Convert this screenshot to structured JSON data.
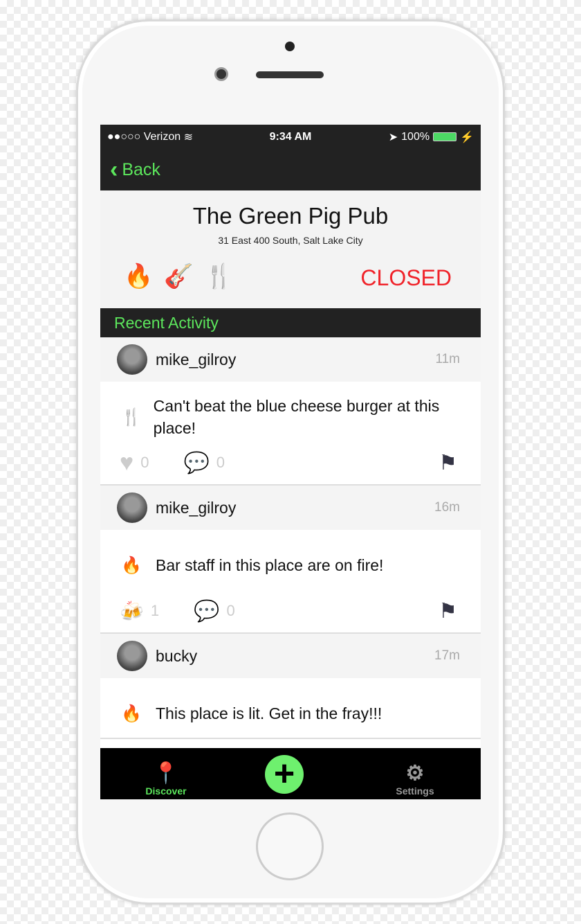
{
  "status": {
    "carrier": "●●○○○ Verizon",
    "time": "9:34 AM",
    "battery": "100%"
  },
  "nav": {
    "back": "Back"
  },
  "venue": {
    "name": "The Green Pig Pub",
    "address": "31 East 400 South, Salt Lake City",
    "status": "CLOSED",
    "icons": [
      "🔥",
      "🎸",
      "🍴"
    ]
  },
  "section": "Recent Activity",
  "posts": [
    {
      "user": "mike_gilroy",
      "time": "11m",
      "icon": "🍴",
      "text": "Can't beat the blue cheese burger at this place!",
      "likes": "0",
      "comments": "0"
    },
    {
      "user": "mike_gilroy",
      "time": "16m",
      "icon": "🔥",
      "text": "Bar staff in this place are on fire!",
      "likes": "1",
      "comments": "0"
    },
    {
      "user": "bucky",
      "time": "17m",
      "icon": "🔥",
      "text": "This place is lit. Get in the fray!!!"
    }
  ],
  "tabs": {
    "discover": "Discover",
    "settings": "Settings"
  },
  "colors": {
    "accent": "#5ce65c",
    "closed": "#f0232a"
  }
}
